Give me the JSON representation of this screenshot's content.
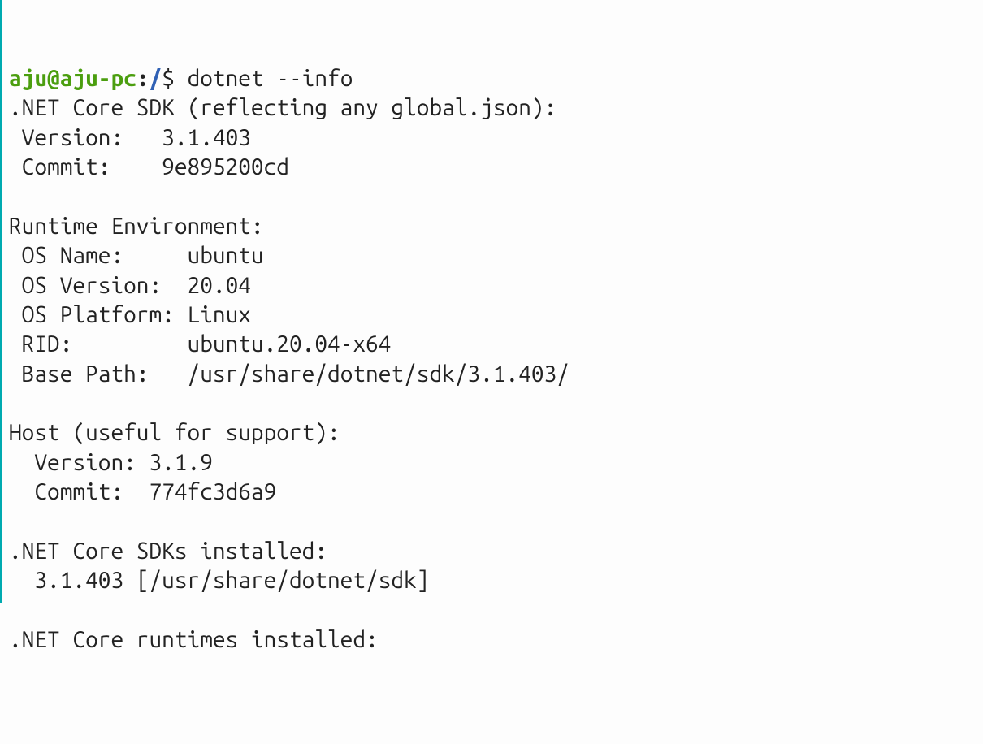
{
  "prompt": {
    "user_host": "aju@aju-pc",
    "separator": ":",
    "path": "/",
    "symbol": "$ "
  },
  "command": "dotnet --info",
  "output": {
    "sdk_header": ".NET Core SDK (reflecting any global.json):",
    "sdk_version_label": " Version:   ",
    "sdk_version_value": "3.1.403",
    "sdk_commit_label": " Commit:    ",
    "sdk_commit_value": "9e895200cd",
    "blank1": "",
    "runtime_env_header": "Runtime Environment:",
    "os_name_label": " OS Name:     ",
    "os_name_value": "ubuntu",
    "os_version_label": " OS Version:  ",
    "os_version_value": "20.04",
    "os_platform_label": " OS Platform: ",
    "os_platform_value": "Linux",
    "rid_label": " RID:         ",
    "rid_value": "ubuntu.20.04-x64",
    "base_path_label": " Base Path:   ",
    "base_path_value": "/usr/share/dotnet/sdk/3.1.403/",
    "blank2": "",
    "host_header": "Host (useful for support):",
    "host_version_label": "  Version: ",
    "host_version_value": "3.1.9",
    "host_commit_label": "  Commit:  ",
    "host_commit_value": "774fc3d6a9",
    "blank3": "",
    "sdks_installed_header": ".NET Core SDKs installed:",
    "sdks_installed_line": "  3.1.403 [/usr/share/dotnet/sdk]",
    "blank4": "",
    "runtimes_installed_header": ".NET Core runtimes installed:"
  }
}
